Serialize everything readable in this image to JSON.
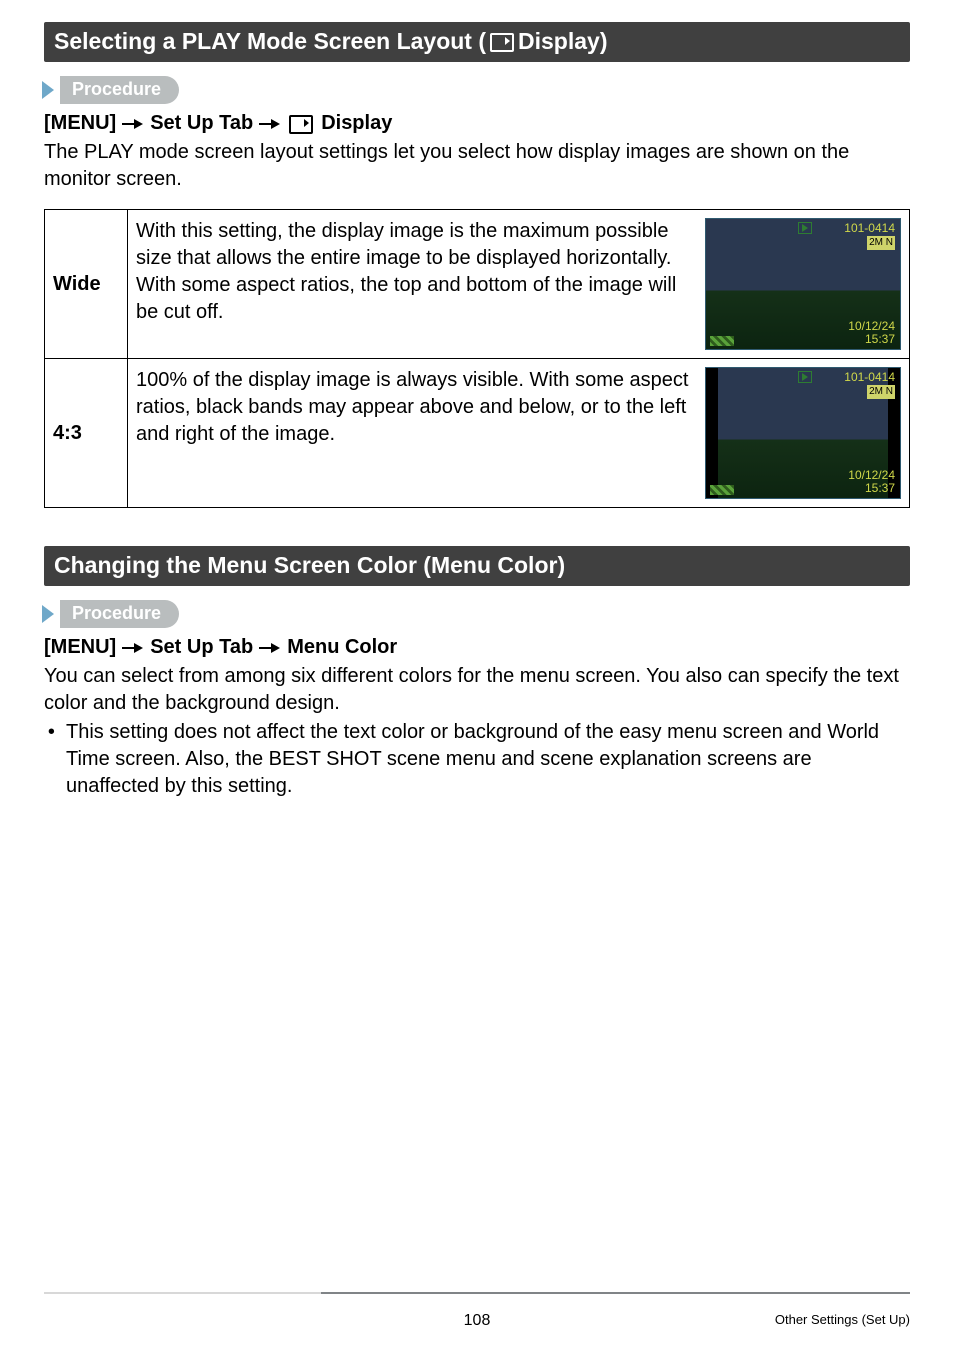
{
  "section1": {
    "title_pre": "Selecting a PLAY Mode Screen Layout (",
    "title_post": " Display)",
    "proc": "Procedure",
    "path": {
      "menu": "[MENU]",
      "tab": "Set Up Tab",
      "item": "Display"
    },
    "intro": "The PLAY mode screen layout settings let you select how display images are shown on the monitor screen.",
    "rows": [
      {
        "key": "Wide",
        "desc": "With this setting, the display image is the maximum possible size that allows the entire image to be displayed horizontally. With some aspect ratios, the top and bottom of the image will be cut off."
      },
      {
        "key": "4:3",
        "desc": "100% of the display image is always visible. With some aspect ratios, black bands may appear above and below, or to the left and right of the image."
      }
    ],
    "thumb": {
      "id": "101-0414",
      "badge": "2M N",
      "date_l1": "10/12/24",
      "date_l2": "15:37"
    }
  },
  "section2": {
    "title": "Changing the Menu Screen Color (Menu Color)",
    "proc": "Procedure",
    "path": {
      "menu": "[MENU]",
      "tab": "Set Up Tab",
      "item": "Menu Color"
    },
    "intro": "You can select from among six different colors for the menu screen. You also can specify the text color and the background design.",
    "bullet": "This setting does not affect the text color or background of the easy menu screen and World Time screen. Also, the BEST SHOT scene menu and scene explanation screens are unaffected by this setting."
  },
  "footer": {
    "page": "108",
    "label": "Other Settings (Set Up)"
  }
}
